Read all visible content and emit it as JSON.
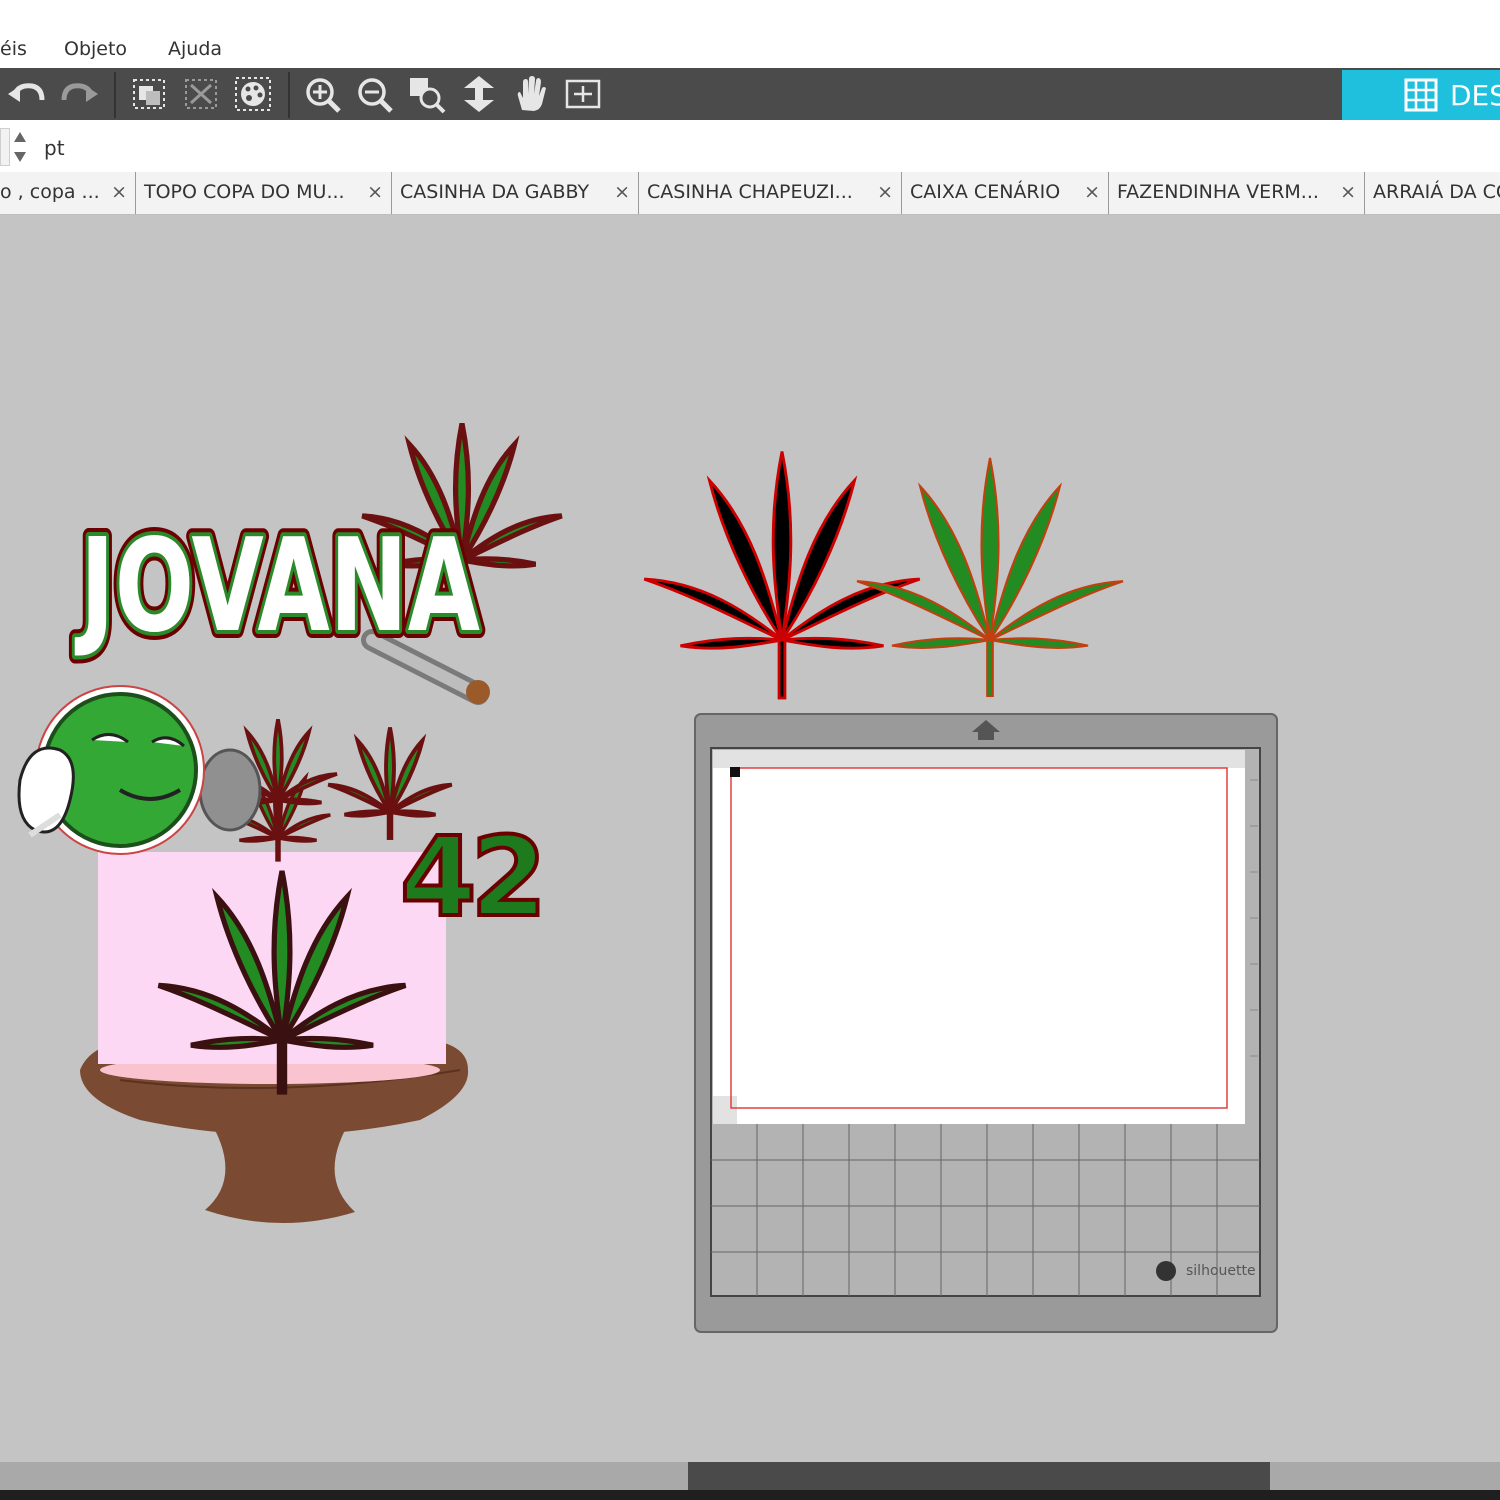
{
  "menu": {
    "items": [
      {
        "label": "éis"
      },
      {
        "label": "Objeto"
      },
      {
        "label": "Ajuda"
      }
    ]
  },
  "toolbar": {
    "design_label": "DES"
  },
  "properties": {
    "unit": "pt"
  },
  "tabs": [
    {
      "label": "o , copa ...",
      "close": "×"
    },
    {
      "label": "TOPO COPA DO MU...",
      "close": "×"
    },
    {
      "label": "CASINHA DA GABBY",
      "close": "×"
    },
    {
      "label": "CASINHA CHAPEUZI...",
      "close": "×"
    },
    {
      "label": "CAIXA CENÁRIO",
      "close": "×"
    },
    {
      "label": "FAZENDINHA VERM...",
      "close": "×"
    },
    {
      "label": "ARRAIÁ DA CO",
      "close": ""
    }
  ],
  "artwork": {
    "name_text": "JOVANA",
    "number_text": "42",
    "mat_brand": "silhouette"
  },
  "colors": {
    "accent": "#1ec0dd",
    "leaf_green": "#228b22",
    "outline_red": "#b01010",
    "cake_pink": "#fcd8f4",
    "stand_brown": "#7b4a32"
  }
}
